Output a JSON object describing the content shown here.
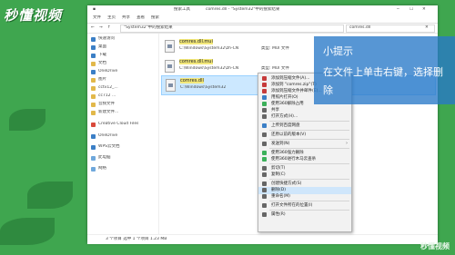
{
  "watermark": {
    "logo": "秒懂视频"
  },
  "window": {
    "title_path": "\"System32\"中的搜索结果",
    "search_query": "comres.dll",
    "ribbon_tabs": [
      "文件",
      "主页",
      "共享",
      "查看",
      "搜索"
    ],
    "address": "\"System32\"中的搜索结果",
    "nav": [
      {
        "label": "快速访问"
      },
      {
        "label": "桌面"
      },
      {
        "label": "下载"
      },
      {
        "label": "文档"
      },
      {
        "label": "OneDrive"
      },
      {
        "label": "图片"
      },
      {
        "label": "cctv12_..."
      },
      {
        "label": "cc712 ..."
      },
      {
        "label": "音频文件"
      },
      {
        "label": "新建文件..."
      },
      {
        "label": "Creative Cloud Files"
      },
      {
        "label": "OneDrive"
      },
      {
        "label": "WPS云文档"
      },
      {
        "label": "此电脑"
      },
      {
        "label": "网络"
      }
    ],
    "results": [
      {
        "name": "comres.dll.mui",
        "path": "C:\\Windows\\System32\\zh-CN",
        "meta": "修改日期: 2019/4/12 23:50",
        "type": "类型: MUI 文件"
      },
      {
        "name": "comres.dll.mui",
        "path": "C:\\Windows\\System32\\zh-CN",
        "meta": "修改日期: 2019/4/12 23:50",
        "type": "类型: MUI 文件"
      },
      {
        "name": "comres.dll",
        "path": "C:\\Windows\\System32",
        "meta": "修改日期: 2019/4/12 23:50",
        "type": "类型: 应用程序扩展"
      }
    ],
    "status": "3 个项目   选中 1 个项目 1.23 MB"
  },
  "context_menu": [
    {
      "label": "添加到压缩文件(A)...",
      "color": "#c63b3b"
    },
    {
      "label": "添加到 \"comres.zip\"(T)",
      "color": "#c63b3b"
    },
    {
      "label": "添加到压缩文件并邮件(E)...",
      "color": "#c63b3b"
    },
    {
      "label": "用照片打开(O)",
      "color": "#3b7fc6"
    },
    {
      "label": "使用360解除占用",
      "color": "#3bb05a"
    },
    {
      "label": "共享",
      "color": "#666666"
    },
    {
      "label": "打开方式(H)...",
      "color": "#666666"
    },
    {
      "sep": true
    },
    {
      "label": "上传到百度网盘",
      "color": "#3b7fc6"
    },
    {
      "sep": true
    },
    {
      "label": "还原以前的版本(V)",
      "color": "#666666"
    },
    {
      "sep": true
    },
    {
      "label": "发送到(N)",
      "color": "#666666",
      "submenu": true
    },
    {
      "sep": true
    },
    {
      "label": "使用360强力删除",
      "color": "#3bb05a"
    },
    {
      "label": "使用360进行木马云查杀",
      "color": "#3bb05a"
    },
    {
      "sep": true
    },
    {
      "label": "剪切(T)",
      "color": "#666666"
    },
    {
      "label": "复制(C)",
      "color": "#666666"
    },
    {
      "sep": true
    },
    {
      "label": "创建快捷方式(S)",
      "color": "#666666"
    },
    {
      "label": "删除(D)",
      "color": "#666666",
      "hover": true
    },
    {
      "label": "重命名(M)",
      "color": "#666666"
    },
    {
      "sep": true
    },
    {
      "label": "打开文件所在的位置(I)",
      "color": "#666666"
    },
    {
      "sep": true
    },
    {
      "label": "属性(R)",
      "color": "#666666"
    }
  ],
  "tip": {
    "title": "小提示",
    "body": "在文件上单击右键，选择删除"
  },
  "corner_logo": "秒懂视频"
}
